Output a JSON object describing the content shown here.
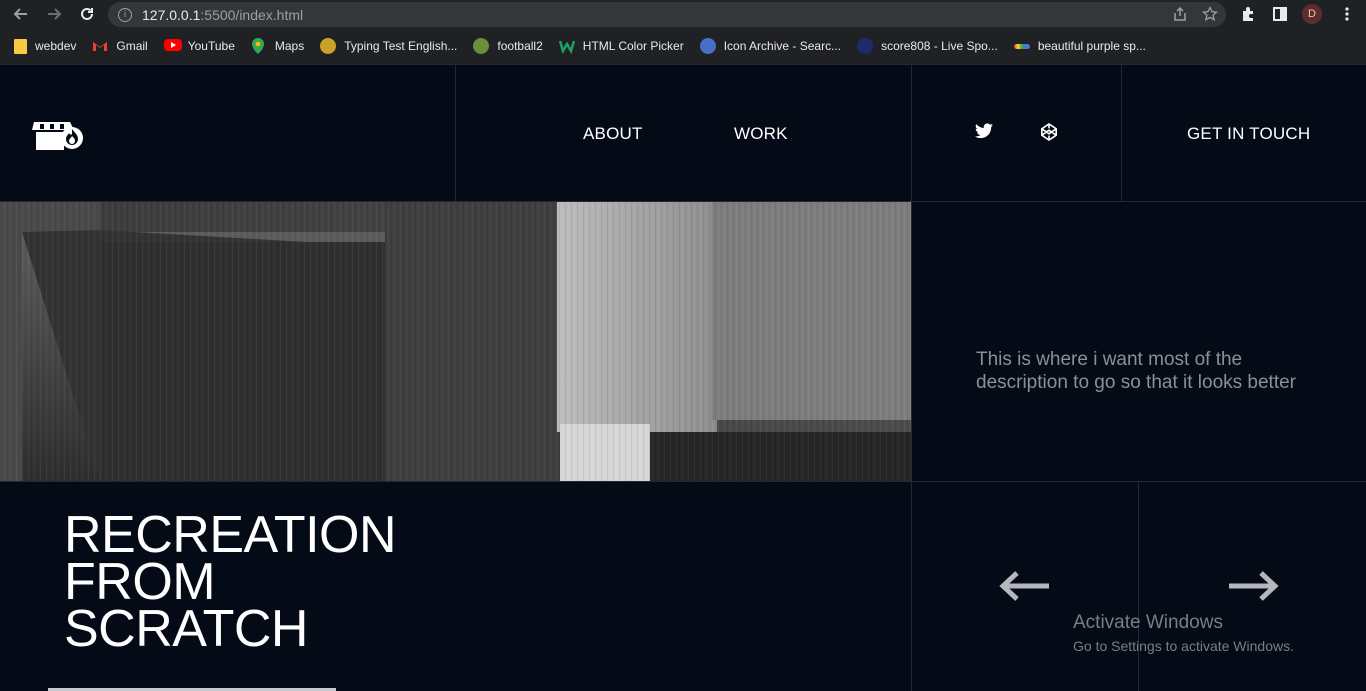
{
  "browser": {
    "url_host": "127.0.0.1",
    "url_path": ":5500/index.html",
    "avatar_letter": "D",
    "bookmarks": [
      {
        "label": "webdev",
        "icon": "folder-icon",
        "color": "#f9c843"
      },
      {
        "label": "Gmail",
        "icon": "gmail-icon",
        "color": "#ea4335"
      },
      {
        "label": "YouTube",
        "icon": "youtube-icon",
        "color": "#ff0000"
      },
      {
        "label": "Maps",
        "icon": "maps-icon",
        "color": "#34a853"
      },
      {
        "label": "Typing Test English...",
        "icon": "typing-icon",
        "color": "#c9a227"
      },
      {
        "label": "football2",
        "icon": "football-icon",
        "color": "#6a8f3a"
      },
      {
        "label": "HTML Color Picker",
        "icon": "color-picker-icon",
        "color": "#1aa260"
      },
      {
        "label": "Icon Archive - Searc...",
        "icon": "star-icon",
        "color": "#4a6fc7"
      },
      {
        "label": "score808 - Live Spo...",
        "icon": "live-icon",
        "color": "#1c2b6a"
      },
      {
        "label": "beautiful purple sp...",
        "icon": "palette-icon",
        "color": "#b04cd6"
      }
    ]
  },
  "header": {
    "nav": [
      "ABOUT",
      "WORK"
    ],
    "social": [
      "twitter-icon",
      "codepen-icon"
    ],
    "cta": "GET IN TOUCH"
  },
  "hero": {
    "description": "This is where i want most of the description to go so that it looks better",
    "title_lines": [
      "RECREATION",
      "FROM",
      "SCRATCH"
    ]
  },
  "watermark": {
    "line1": "Activate Windows",
    "line2": "Go to Settings to activate Windows."
  },
  "colors": {
    "background": "#050a17",
    "grid_line": "#222838",
    "text": "#ffffff",
    "muted": "#8c8f99"
  }
}
